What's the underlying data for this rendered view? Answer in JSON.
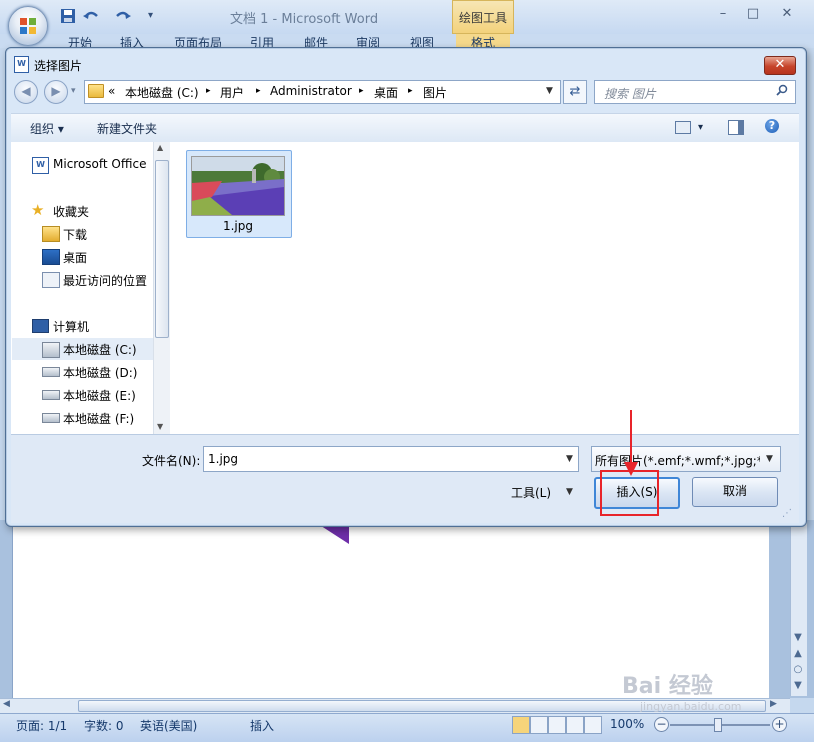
{
  "word": {
    "title": "文档 1 - Microsoft Word",
    "contextual_tab_group": "绘图工具",
    "ribbon_tabs": [
      "开始",
      "插入",
      "页面布局",
      "引用",
      "邮件",
      "审阅",
      "视图"
    ],
    "format_tab": "格式",
    "window_buttons": {
      "minimize": "–",
      "maximize": "□",
      "close": "✕"
    }
  },
  "dialog": {
    "title": "选择图片",
    "close_glyph": "✕",
    "nav": {
      "back": "◀",
      "forward": "▶",
      "recent": "▾"
    },
    "breadcrumb": [
      "«",
      "本地磁盘 (C:)",
      "▸",
      "用户",
      "▸",
      "Administrator",
      "▸",
      "桌面",
      "▸",
      "图片"
    ],
    "search_placeholder": "搜索 图片",
    "toolbar": {
      "organize": "组织 ▾",
      "new_folder": "新建文件夹",
      "view_dropdown": "▾",
      "help": "?"
    },
    "nav_pane": [
      {
        "label": "Microsoft Office",
        "icon": "office-icon"
      },
      {
        "label": "收藏夹",
        "icon": "star-icon"
      },
      {
        "label": "下载",
        "icon": "download-folder-icon"
      },
      {
        "label": "桌面",
        "icon": "desktop-icon"
      },
      {
        "label": "最近访问的位置",
        "icon": "recent-places-icon"
      },
      {
        "label": "计算机",
        "icon": "computer-icon"
      },
      {
        "label": "本地磁盘 (C:)",
        "icon": "drive-icon",
        "selected": true
      },
      {
        "label": "本地磁盘 (D:)",
        "icon": "drive-icon"
      },
      {
        "label": "本地磁盘 (E:)",
        "icon": "drive-icon"
      },
      {
        "label": "本地磁盘 (F:)",
        "icon": "drive-icon"
      }
    ],
    "files": [
      {
        "name": "1.jpg",
        "selected": true
      }
    ],
    "filename_label": "文件名(N):",
    "filename_value": "1.jpg",
    "filetype_value": "所有图片(*.emf;*.wmf;*.jpg;*.jp",
    "tools_label": "工具(L)",
    "insert_button": "插入(S)",
    "cancel_button": "取消"
  },
  "status": {
    "page": "页面: 1/1",
    "words": "字数: 0",
    "language": "英语(美国)",
    "mode": "插入",
    "zoom": "100%"
  },
  "watermark": {
    "main": "Bai 经验",
    "sub": "jingyan.baidu.com"
  },
  "colors": {
    "accent": "#3f86d7",
    "highlight": "#e8242a",
    "shape": "#6e2fa8"
  }
}
